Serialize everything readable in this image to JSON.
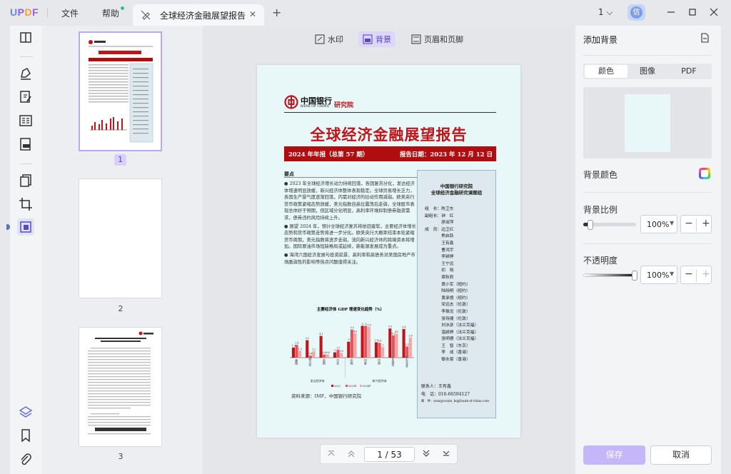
{
  "titlebar": {
    "logo": {
      "u": "U",
      "p": "P",
      "d": "D",
      "f": "F"
    },
    "menu_file": "文件",
    "menu_help": "帮助",
    "tab_title": "全球经济金融展望报告",
    "page_indicator": "1",
    "avatar_initial": "信"
  },
  "toolbar": {
    "watermark": "水印",
    "background": "背景",
    "header_footer": "页眉和页脚"
  },
  "thumbnails": {
    "pages": [
      "1",
      "2",
      "3"
    ]
  },
  "pager": {
    "current": "1",
    "total": "53",
    "display": "1 / 53"
  },
  "panel": {
    "title": "添加背景",
    "tabs": [
      "颜色",
      "图像",
      "PDF"
    ],
    "bg_color_label": "背景颜色",
    "scale_label": "背景比例",
    "scale_value": "100%",
    "scale_level": 0.14,
    "opacity_label": "不透明度",
    "opacity_value": "100%",
    "opacity_level": 1.0,
    "save": "保存",
    "cancel": "取消",
    "bg_color": "#e8f7f7"
  },
  "document": {
    "logo_cn": "中国银行",
    "logo_en": "BANK OF CHINA",
    "institute": "研究院",
    "title": "全球经济金融展望报告",
    "bar_left": "2024 年年报（总第 57 期）",
    "bar_right": "报告日期：2023 年 12 月 12 日",
    "section": "要点",
    "paragraphs": [
      "● 2023 年全球经济增长动力持续回落，各国复苏分化，发达经济体增速明显放缓，新兴经济体整体表现稳定。全球贸易增长乏力，各国生产景气度逐渐回落，内需对经济的拉动作用减弱。欧美央行货币政策紧缩态势放缓，美元指数自高位震荡后走弱，全球股市表现总体好于预期，但区域分化明显，高利率环境抑制债券融资需求，债券违约风险持续上升。",
      "● 展望 2024 年，预计全球经济复苏将依旧疲软，主要经济体增长态势和货币政策走势将进一步分化。欧美央行大概率结束本轮紧缩货币周期，美元指数将逐步走弱，流向新兴经济体的跨境资本将增加。国际原油市场短缺格局或延续，新能源发展成为重点。",
      "● 海湾六国经济发展与投资前景、高利率和高债务对美国房地产市场脆弱性的影响等热点问题值得关注。"
    ],
    "side_title_1": "中国银行研究院",
    "side_title_2": "全球经济金融研究课题组",
    "side_lines": [
      "组　长：陈卫东",
      "副组长：钟　红",
      "　　　　廖淑萍",
      "成　员：边卫红",
      "　　　　熊启跃",
      "　　　　王有鑫",
      "　　　　曹鸿宇",
      "　　　　李颖婷",
      "　　　　王宁远",
      "　　　　初　晓",
      "　　　　章秋莉",
      "　　　　黄小军（纽约）",
      "　　　　陆晓明（纽约）",
      "　　　　黄承煜（纽约）",
      "　　　　宋远志（伦敦）",
      "　　　　李振龙（伦敦）",
      "　　　　张侍捷（伦敦）",
      "　　　　刘冰彦（法兰克福）",
      "　　　　温颖婷（法兰克福）",
      "　　　　张明德（法兰克福）",
      "　　　　王　智（东京）",
      "　　　　李　成（香港）",
      "　　　　黎永豪（香港）"
    ],
    "contact_1": "联系人：王有鑫",
    "contact_2": "电　话：010-66594127",
    "contact_3": "邮　件：wangyouxin_hq@bank-of-china.com",
    "chart_title": "主要经济体 GDP 增速变化趋势（%）",
    "chart_source": "资料来源：IMF，中国银行研究院",
    "chart_legend": [
      "2022",
      "2023E",
      "2024F"
    ],
    "chart_group_1": "发达经济体",
    "chart_group_2": "新兴经济体",
    "chart_categories": [
      "美国",
      "欧元区",
      "英国",
      "日本",
      "中国",
      "印度",
      "巴西",
      "东南亚",
      "中东北非"
    ],
    "chart_values": [
      [
        1.9,
        2.4,
        1.3
      ],
      [
        3.3,
        0.4,
        1.2
      ],
      [
        4.1,
        0.6,
        0.6
      ],
      [
        1.0,
        1.5,
        0.9
      ],
      [
        3.0,
        5.3,
        4.6
      ],
      [
        6.0,
        6.0,
        5.8
      ],
      [
        2.9,
        2.8,
        2.0
      ],
      [
        5.5,
        4.2,
        4.5
      ],
      [
        5.4,
        2.1,
        3.8
      ]
    ]
  },
  "chart_data": {
    "type": "bar",
    "title": "主要经济体 GDP 增速变化趋势（%）",
    "categories": [
      "美国",
      "欧元区",
      "英国",
      "日本",
      "中国",
      "印度",
      "巴西",
      "东南亚",
      "中东北非"
    ],
    "series": [
      {
        "name": "2022",
        "values": [
          1.9,
          3.3,
          4.1,
          1.0,
          3.0,
          6.0,
          2.9,
          5.5,
          5.4
        ]
      },
      {
        "name": "2023E",
        "values": [
          2.4,
          0.4,
          0.6,
          1.5,
          5.3,
          6.0,
          2.8,
          4.2,
          2.1
        ]
      },
      {
        "name": "2024F",
        "values": [
          1.3,
          1.2,
          0.6,
          0.9,
          4.6,
          5.8,
          2.0,
          4.5,
          3.8
        ]
      }
    ],
    "ylim": [
      0,
      7
    ],
    "legend": "bottom"
  }
}
